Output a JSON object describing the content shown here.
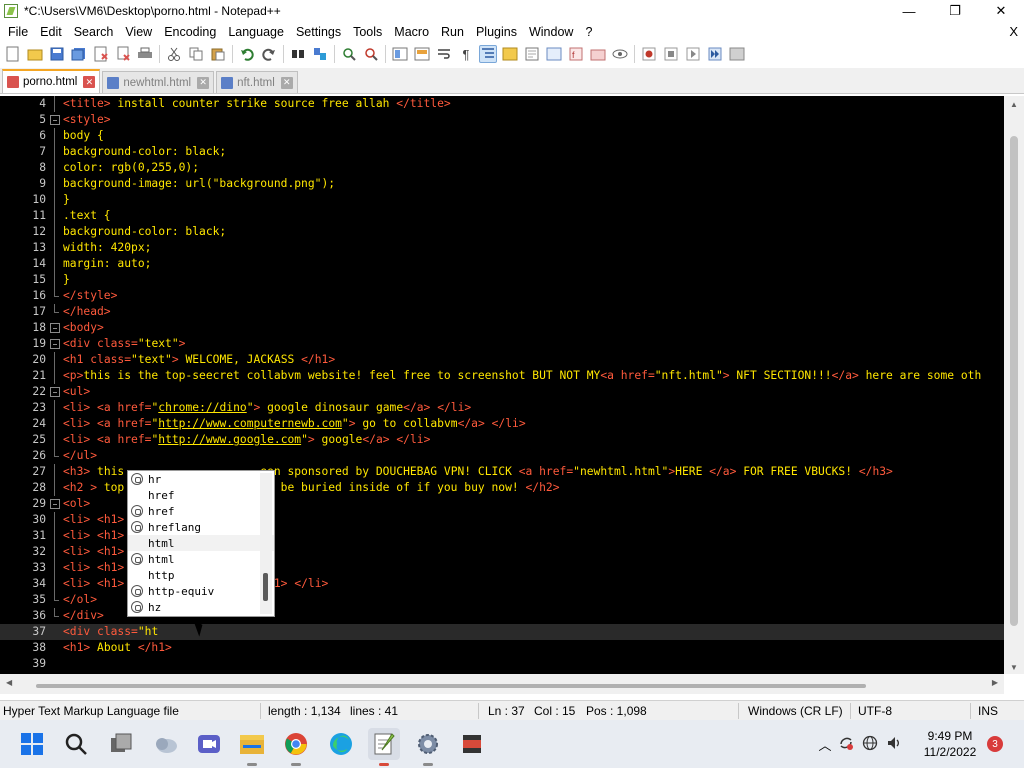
{
  "window": {
    "title": "*C:\\Users\\VM6\\Desktop\\porno.html - Notepad++",
    "minimize": "—",
    "maximize": "❐",
    "close": "✕"
  },
  "menu": {
    "items": [
      "File",
      "Edit",
      "Search",
      "View",
      "Encoding",
      "Language",
      "Settings",
      "Tools",
      "Macro",
      "Run",
      "Plugins",
      "Window",
      "?"
    ],
    "close": "X"
  },
  "tabs": [
    {
      "label": "porno.html",
      "active": true
    },
    {
      "label": "newhtml.html",
      "active": false
    },
    {
      "label": "nft.html",
      "active": false
    }
  ],
  "editor": {
    "lines": [
      {
        "n": "4",
        "fold": "vline",
        "html": "<span class='tag'>&lt;title&gt;</span><span class='txt'> install counter strike source free allah </span><span class='tag'>&lt;/title&gt;</span>"
      },
      {
        "n": "5",
        "fold": "box",
        "html": "<span class='tag'>&lt;style&gt;</span>"
      },
      {
        "n": "6",
        "fold": "vline",
        "html": "<span class='txt'>body {</span>"
      },
      {
        "n": "7",
        "fold": "vline",
        "html": "<span class='txt'>background-color: black;</span>"
      },
      {
        "n": "8",
        "fold": "vline",
        "html": "<span class='txt'>color: rgb(0,255,0);</span>"
      },
      {
        "n": "9",
        "fold": "vline",
        "html": "<span class='txt'>background-image: url(\"background.png\");</span>"
      },
      {
        "n": "10",
        "fold": "vline",
        "html": "<span class='txt'>}</span>"
      },
      {
        "n": "11",
        "fold": "vline",
        "html": "<span class='txt'>.text {</span>"
      },
      {
        "n": "12",
        "fold": "vline",
        "html": "<span class='txt'>background-color: black;</span>"
      },
      {
        "n": "13",
        "fold": "vline",
        "html": "<span class='txt'>width: 420px;</span>"
      },
      {
        "n": "14",
        "fold": "vline",
        "html": "<span class='txt'>margin: auto;</span>"
      },
      {
        "n": "15",
        "fold": "vline",
        "html": "<span class='txt'>}</span>"
      },
      {
        "n": "16",
        "fold": "end",
        "html": "<span class='tag'>&lt;/style&gt;</span>"
      },
      {
        "n": "17",
        "fold": "end",
        "html": "<span class='tag'>&lt;/head&gt;</span>"
      },
      {
        "n": "18",
        "fold": "box",
        "html": "<span class='tag'>&lt;body&gt;</span>"
      },
      {
        "n": "19",
        "fold": "box",
        "html": "<span class='tag'>&lt;div </span><span class='attr'>class</span><span class='tag'>=</span><span class='str'>\"text\"</span><span class='tag'>&gt;</span>"
      },
      {
        "n": "20",
        "fold": "vline",
        "html": "<span class='tag'>&lt;h1 </span><span class='attr'>class</span><span class='tag'>=</span><span class='str'>\"text\"</span><span class='tag'>&gt;</span><span class='txt'> WELCOME, JACKASS </span><span class='tag'>&lt;/h1&gt;</span>"
      },
      {
        "n": "21",
        "fold": "vline",
        "html": "<span class='tag'>&lt;p&gt;</span><span class='txt'>this is the top-seecret collabvm website! feel free to screenshot BUT NOT MY</span><span class='tag'>&lt;a </span><span class='attr'>href</span><span class='tag'>=</span><span class='str'>\"nft.html\"</span><span class='tag'>&gt;</span><span class='txt'> NFT SECTION!!!</span><span class='tag'>&lt;/a&gt;</span><span class='txt'> here are some oth</span>"
      },
      {
        "n": "22",
        "fold": "box",
        "html": "<span class='tag'>&lt;ul&gt;</span>"
      },
      {
        "n": "23",
        "fold": "vline",
        "html": "<span class='tag'>&lt;li&gt;</span> <span class='tag'>&lt;a </span><span class='attr'>href</span><span class='tag'>=</span><span class='str'>\"</span><span class='url'>chrome://dino</span><span class='str'>\"</span><span class='tag'>&gt;</span><span class='txt'> google dinosaur game</span><span class='tag'>&lt;/a&gt;</span> <span class='tag'>&lt;/li&gt;</span>"
      },
      {
        "n": "24",
        "fold": "vline",
        "html": "<span class='tag'>&lt;li&gt;</span> <span class='tag'>&lt;a </span><span class='attr'>href</span><span class='tag'>=</span><span class='str'>\"</span><span class='url'>http://www.computernewb.com</span><span class='str'>\"</span><span class='tag'>&gt;</span><span class='txt'> go to collabvm</span><span class='tag'>&lt;/a&gt;</span> <span class='tag'>&lt;/li&gt;</span>"
      },
      {
        "n": "25",
        "fold": "vline",
        "html": "<span class='tag'>&lt;li&gt;</span> <span class='tag'>&lt;a </span><span class='attr'>href</span><span class='tag'>=</span><span class='str'>\"</span><span class='url'>http://www.google.com</span><span class='str'>\"</span><span class='tag'>&gt;</span><span class='txt'> google</span><span class='tag'>&lt;/a&gt;</span> <span class='tag'>&lt;/li&gt;</span>"
      },
      {
        "n": "26",
        "fold": "end",
        "html": "<span class='tag'>&lt;/ul&gt;</span>"
      },
      {
        "n": "27",
        "fold": "vline",
        "html": "<span class='tag'>&lt;h3&gt;</span><span class='txt'> this                    een sponsored by DOUCHEBAG VPN! CLICK </span><span class='tag'>&lt;a </span><span class='attr'>href</span><span class='tag'>=</span><span class='str'>\"newhtml.html\"</span><span class='tag'>&gt;</span><span class='txt'>HERE </span><span class='tag'>&lt;/a&gt;</span><span class='txt'> FOR FREE VBUCKS! </span><span class='tag'>&lt;/h3&gt;</span>"
      },
      {
        "n": "28",
        "fold": "vline",
        "html": "<span class='tag'>&lt;h2 &gt;</span><span class='txt'> top                    ld be buried inside of if you buy now! </span><span class='tag'>&lt;/h2&gt;</span>"
      },
      {
        "n": "29",
        "fold": "box",
        "html": "<span class='tag'>&lt;ol&gt;</span>"
      },
      {
        "n": "30",
        "fold": "vline",
        "html": "<span class='tag'>&lt;li&gt;</span> <span class='tag'>&lt;h1&gt;</span>"
      },
      {
        "n": "31",
        "fold": "vline",
        "html": "<span class='tag'>&lt;li&gt;</span> <span class='tag'>&lt;h1&gt;</span>"
      },
      {
        "n": "32",
        "fold": "vline",
        "html": "<span class='tag'>&lt;li&gt;</span> <span class='tag'>&lt;h1&gt;</span>"
      },
      {
        "n": "33",
        "fold": "vline",
        "html": "<span class='tag'>&lt;li&gt;</span> <span class='tag'>&lt;h1&gt;</span>"
      },
      {
        "n": "34",
        "fold": "vline",
        "html": "<span class='tag'>&lt;li&gt;</span> <span class='tag'>&lt;h1&gt;</span>                    <span class='tag'>/h1&gt;</span> <span class='tag'>&lt;/li&gt;</span>"
      },
      {
        "n": "35",
        "fold": "end",
        "html": "<span class='tag'>&lt;/ol&gt;</span>"
      },
      {
        "n": "36",
        "fold": "end",
        "html": "<span class='tag'>&lt;/div&gt;</span>"
      },
      {
        "n": "37",
        "fold": "none",
        "current": true,
        "html": "<span class='tag'>&lt;div </span><span class='attr'>class</span><span class='tag'>=</span><span class='str'>\"ht</span>"
      },
      {
        "n": "38",
        "fold": "none",
        "html": "<span class='tag'>&lt;h1&gt;</span><span class='txt'> About </span><span class='tag'>&lt;/h1&gt;</span>"
      },
      {
        "n": "39",
        "fold": "none",
        "html": ""
      }
    ]
  },
  "autocomplete": {
    "items": [
      {
        "label": "hr",
        "icon": true
      },
      {
        "label": "href",
        "icon": false
      },
      {
        "label": "href",
        "icon": true
      },
      {
        "label": "hreflang",
        "icon": true
      },
      {
        "label": "html",
        "icon": false,
        "selected": true
      },
      {
        "label": "html",
        "icon": true
      },
      {
        "label": "http",
        "icon": false
      },
      {
        "label": "http-equiv",
        "icon": true
      },
      {
        "label": "hz",
        "icon": true
      }
    ]
  },
  "status": {
    "file_type": "Hyper Text Markup Language file",
    "length": "length : 1,134",
    "lines": "lines : 41",
    "ln": "Ln : 37",
    "col": "Col : 15",
    "pos": "Pos : 1,098",
    "eol": "Windows (CR LF)",
    "encoding": "UTF-8",
    "mode": "INS"
  },
  "taskbar": {
    "time": "9:49 PM",
    "date": "11/2/2022",
    "notification_count": "3",
    "apps": [
      "start-icon",
      "search-icon",
      "task-view-icon",
      "weather-icon",
      "video-icon",
      "file-explorer-icon",
      "chrome-icon",
      "edge-icon",
      "notepad-plus-plus-icon",
      "settings-icon",
      "media-icon"
    ]
  }
}
